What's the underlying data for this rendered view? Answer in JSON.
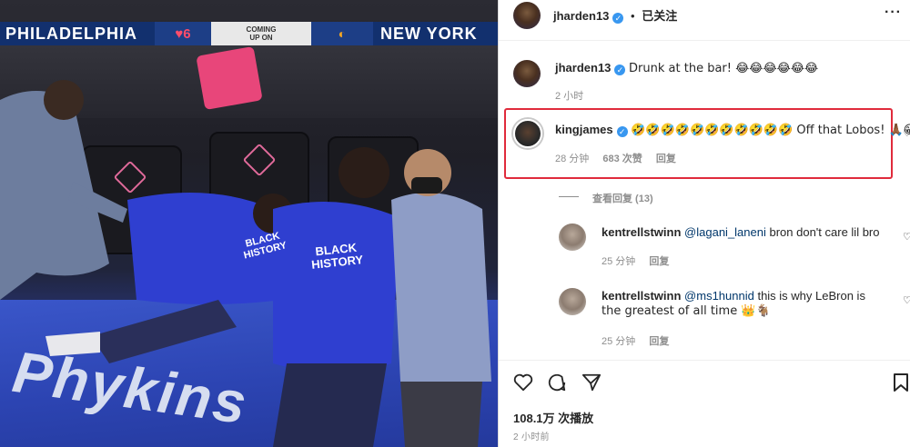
{
  "video": {
    "scoreboard": {
      "home_team": "PHILADELPHIA",
      "coming_up_line1": "COMING",
      "coming_up_line2": "UP ON",
      "away_team": "NEW YORK"
    },
    "jersey_text_1": "BLACK HISTORY",
    "jersey_text_2": "BLACK HISTORY",
    "floor_text": "Phykins"
  },
  "post": {
    "header": {
      "username": "jharden13",
      "separator": "•",
      "follow_status": "已关注",
      "more": "···"
    },
    "caption": {
      "username": "jharden13",
      "text": "Drunk at the bar! 😂😂😂😂😂😂",
      "time": "2 小时"
    },
    "comments": [
      {
        "username": "kingjames",
        "text": "🤣🤣🤣🤣🤣🤣🤣🤣🤣🤣🤣 Off that Lobos! 🙏🏾😁",
        "time": "28 分钟",
        "likes": "683 次赞",
        "reply_label": "回复"
      }
    ],
    "view_replies": "查看回复 (13)",
    "replies": [
      {
        "username": "kentrellstwinn",
        "mention": "@lagani_laneni",
        "text": " bron don't care lil bro",
        "time": "25 分钟",
        "reply_label": "回复"
      },
      {
        "username": "kentrellstwinn",
        "mention": "@ms1hunnid",
        "text": " this is why LeBron is",
        "text2": "the greatest of all time 👑🐐",
        "time": "25 分钟",
        "reply_label": "回复"
      }
    ],
    "views": "108.1万 次播放",
    "posted_time": "2 小时前"
  },
  "colors": {
    "highlight_border": "#e02b3c",
    "verified": "#3897f0",
    "mention": "#00376b",
    "meta": "#8e8e8e"
  }
}
